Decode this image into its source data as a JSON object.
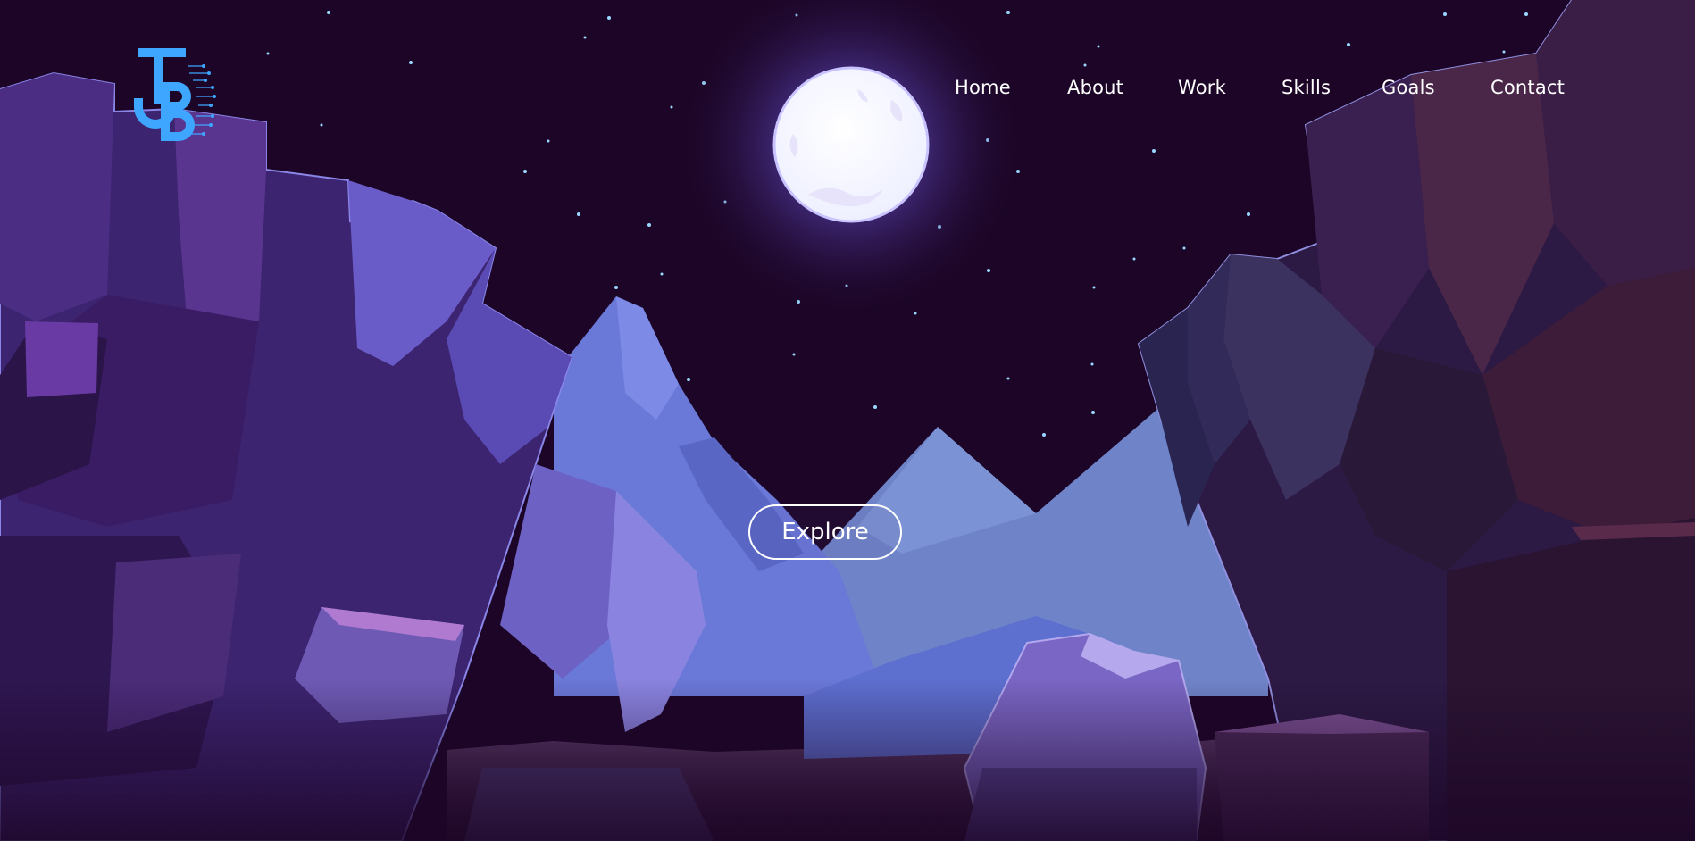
{
  "logo": {
    "icon": "jb-monogram-logo-icon",
    "color": "#3ea6ff"
  },
  "nav": {
    "items": [
      {
        "label": "Home"
      },
      {
        "label": "About"
      },
      {
        "label": "Work"
      },
      {
        "label": "Skills"
      },
      {
        "label": "Goals"
      },
      {
        "label": "Contact"
      }
    ]
  },
  "hero": {
    "button_label": "Explore",
    "scene": "night-canyon-moon-illustration"
  },
  "colors": {
    "sky": "#1c0526",
    "moon": "#ffffff",
    "moon_glow": "#6b5bd8",
    "cliff_left": "#4a2a78",
    "cliff_right": "#2a1740",
    "mountain": "#7080d8",
    "accent": "#3ea6ff"
  }
}
